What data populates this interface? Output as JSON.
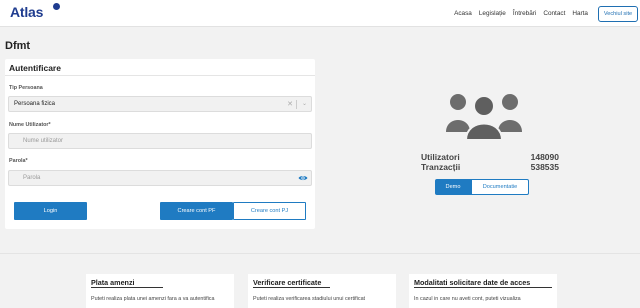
{
  "brand": {
    "logo_text": "Atlas",
    "accent": "#1f7bc2",
    "logo_color": "#1f3c8f"
  },
  "nav": {
    "items": [
      "Acasa",
      "Legislație",
      "Întrebări",
      "Contact",
      "Harta"
    ],
    "old_site_label": "Vechiul site"
  },
  "page": {
    "title": "Dfmt"
  },
  "auth": {
    "title": "Autentificare",
    "person_type_label": "Tip Persoana",
    "person_type_value": "Persoana fizica",
    "username_label": "Nume Utilizator*",
    "username_placeholder": "Nume utilizator",
    "password_label": "Parola*",
    "password_placeholder": "Parola",
    "login_label": "Login",
    "create_pf_label": "Creare cont PF",
    "create_pj_label": "Creare cont PJ"
  },
  "stats": {
    "icon": "users-group-icon",
    "users_label": "Utilizatori",
    "users_value": "148090",
    "transactions_label": "Tranzacții",
    "transactions_value": "538535",
    "demo_label": "Demo",
    "docs_label": "Documentatie"
  },
  "info_cards": [
    {
      "title": "Plata amenzi",
      "text": "Puteti realiza plata unei amenzi fara a va autentifica"
    },
    {
      "title": "Verificare certificate",
      "text": "Puteti realiza verificarea stadiului unui certificat"
    },
    {
      "title": "Modalitati solicitare date de acces",
      "text": "In cazul in care nu aveti cont, puteti vizualiza"
    }
  ]
}
